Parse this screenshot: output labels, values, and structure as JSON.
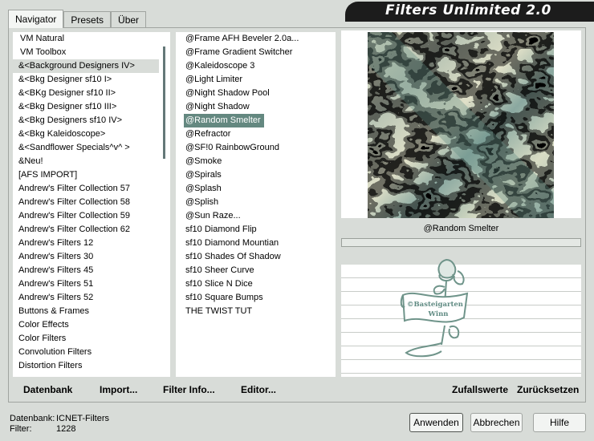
{
  "tabs": [
    {
      "label": "Navigator",
      "active": true
    },
    {
      "label": "Presets",
      "active": false
    },
    {
      "label": "Über",
      "active": false
    }
  ],
  "title": "Filters Unlimited 2.0",
  "categories": [
    "VM Natural",
    "VM Toolbox",
    "&<Background Designers IV>",
    "&<Bkg Designer sf10 I>",
    "&<BKg Designer sf10 II>",
    "&<Bkg Designer sf10 III>",
    "&<Bkg Designers sf10 IV>",
    "&<Bkg Kaleidoscope>",
    "&<Sandflower Specials^v^ >",
    "&Neu!",
    "[AFS IMPORT]",
    "Andrew's Filter Collection 57",
    "Andrew's Filter Collection 58",
    "Andrew's Filter Collection 59",
    "Andrew's Filter Collection 62",
    "Andrew's Filters 12",
    "Andrew's Filters 30",
    "Andrew's Filters 45",
    "Andrew's Filters 51",
    "Andrew's Filters 52",
    "Buttons & Frames",
    "Color Effects",
    "Color Filters",
    "Convolution Filters",
    "Distortion Filters"
  ],
  "selected_category": "&<Background Designers IV>",
  "filters": [
    "@Frame AFH Beveler 2.0a...",
    "@Frame Gradient Switcher",
    "@Kaleidoscope 3",
    "@Light Limiter",
    "@Night Shadow Pool",
    "@Night Shadow",
    "@Random Smelter",
    "@Refractor",
    "@SF!0 RainbowGround",
    "@Smoke",
    "@Spirals",
    "@Splash",
    "@Splish",
    "@Sun Raze...",
    "sf10 Diamond Flip",
    "sf10 Diamond Mountian",
    "sf10 Shades Of Shadow",
    "sf10 Sheer Curve",
    "sf10 Slice N Dice",
    "sf10 Square Bumps",
    "THE TWIST TUT"
  ],
  "selected_filter": "@Random Smelter",
  "preview_filter_name": "@Random Smelter",
  "logo": {
    "line1": "©Basteigarten",
    "line2": "Winn"
  },
  "actions": {
    "database": "Datenbank",
    "import": "Import...",
    "filter_info": "Filter Info...",
    "editor": "Editor...",
    "random": "Zufallswerte",
    "reset": "Zurücksetzen"
  },
  "status": {
    "db_label": "Datenbank:",
    "db_value": "ICNET-Filters",
    "filter_label": "Filter:",
    "filter_value": "1228"
  },
  "buttons": {
    "apply": "Anwenden",
    "cancel": "Abbrechen",
    "help": "Hilfe"
  },
  "colors": {
    "accent": "#648880",
    "texture_light": "#e6e4cc",
    "texture_dark": "#7c9a94"
  }
}
